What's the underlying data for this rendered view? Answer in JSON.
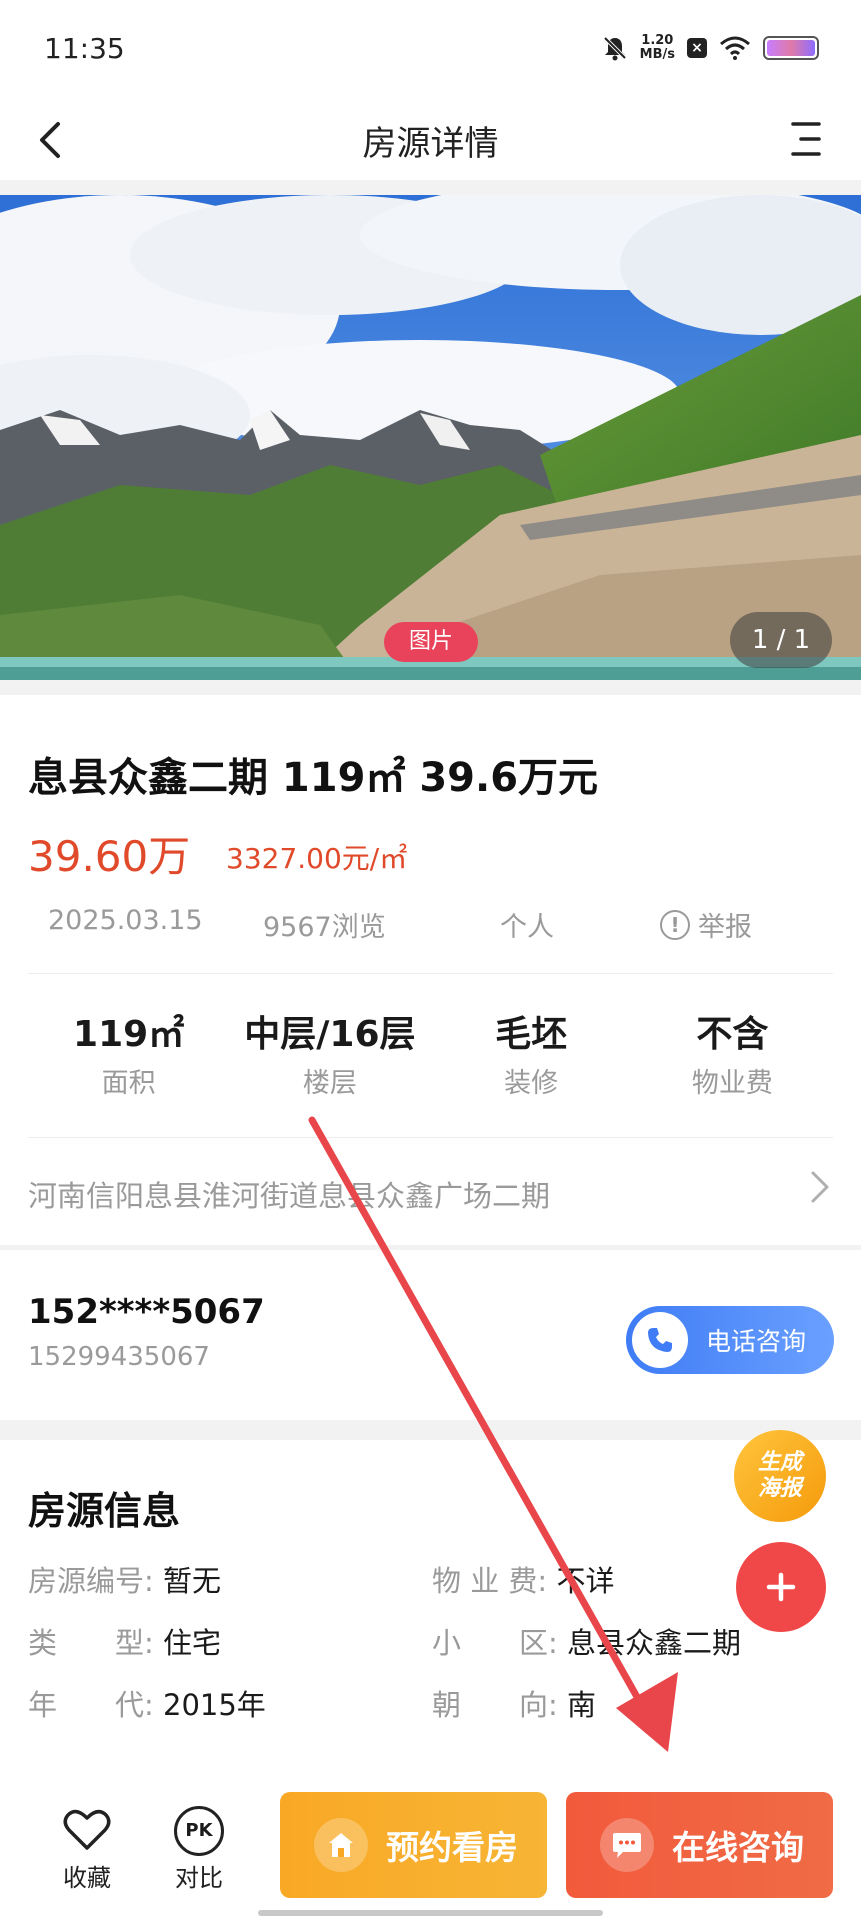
{
  "status_bar": {
    "time": "11:35",
    "net_speed_value": "1.20",
    "net_speed_unit": "MB/s"
  },
  "header": {
    "title": "房源详情"
  },
  "gallery": {
    "photo_tag": "图片",
    "counter": "1 / 1"
  },
  "listing": {
    "title": "息县众鑫二期 119㎡ 39.6万元",
    "price_total": "39.60万",
    "price_unit": "3327.00元/㎡",
    "date": "2025.03.15",
    "views": "9567浏览",
    "owner_type": "个人",
    "report_label": "举报",
    "specs": [
      {
        "value": "119㎡",
        "label": "面积"
      },
      {
        "value": "中层/16层",
        "label": "楼层"
      },
      {
        "value": "毛坯",
        "label": "装修"
      },
      {
        "value": "不含",
        "label": "物业费"
      }
    ],
    "address": "河南信阳息县淮河街道息县众鑫广场二期"
  },
  "contact": {
    "masked_phone": "152****5067",
    "full_phone": "15299435067",
    "call_label": "电话咨询"
  },
  "info": {
    "title": "房源信息",
    "rows": [
      {
        "key": "房源编号:",
        "value": "暂无"
      },
      {
        "key": "物 业 费:",
        "value": "不详"
      },
      {
        "key": "类　　型:",
        "value": "住宅"
      },
      {
        "key": "小　　区:",
        "value": "息县众鑫二期"
      },
      {
        "key": "年　　代:",
        "value": "2015年"
      },
      {
        "key": "朝　　向:",
        "value": "南"
      }
    ]
  },
  "floating": {
    "poster_line1": "生成",
    "poster_line2": "海报"
  },
  "bottom_bar": {
    "favorite_label": "收藏",
    "compare_icon_text": "PK",
    "compare_label": "对比",
    "visit_label": "预约看房",
    "chat_label": "在线咨询"
  },
  "colors": {
    "price": "#e04a2a",
    "call_button": "#3f7cf5",
    "visit_button": "#f9a825",
    "chat_button": "#f25a3c",
    "photo_tag": "#e8435a",
    "annotation_arrow": "#e8464a"
  },
  "icons": [
    "back-arrow-icon",
    "menu-icon",
    "mute-bell-icon",
    "wifi-icon",
    "battery-icon",
    "report-icon",
    "chevron-right-icon",
    "phone-icon",
    "plus-icon",
    "heart-icon",
    "pk-icon",
    "home-icon",
    "chat-bubble-icon"
  ]
}
